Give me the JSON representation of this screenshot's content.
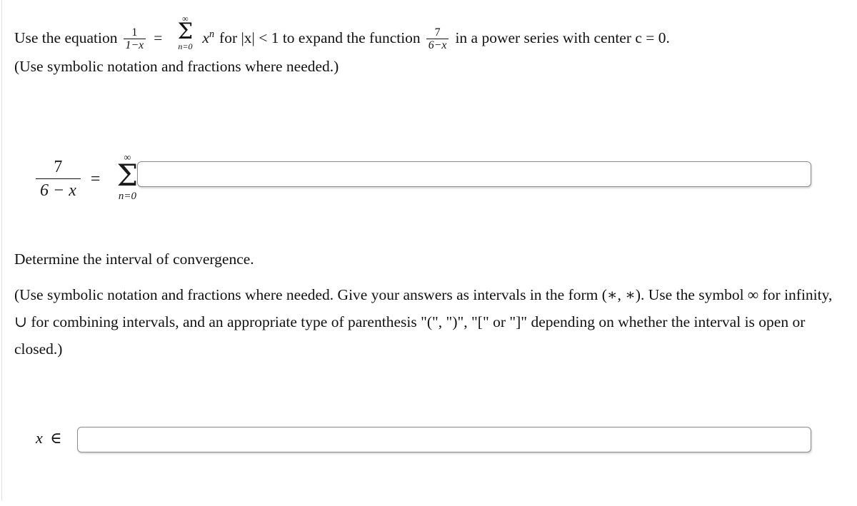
{
  "problem": {
    "prompt_prefix": "Use the equation",
    "equation_inline": {
      "fraction1": {
        "numerator": "1",
        "denominator": "1−x"
      },
      "equals": "=",
      "summation": {
        "upper_limit": "∞",
        "symbol": "Σ",
        "lower_limit": "n=0"
      },
      "term": "x",
      "term_exponent": "n"
    },
    "prompt_middle": "for |x| < 1 to expand the function",
    "function": {
      "numerator": "7",
      "denominator": "6−x"
    },
    "prompt_suffix": "in a power series with center c = 0.",
    "note_1": "(Use symbolic notation and fractions where needed.)"
  },
  "display_equation": {
    "left_fraction": {
      "numerator": "7",
      "denominator": "6 − x"
    },
    "equals": "=",
    "summation": {
      "upper_limit": "∞",
      "symbol": "Σ",
      "lower_limit": "n=0"
    }
  },
  "answer_1": {
    "value": "",
    "placeholder": ""
  },
  "interval_section": {
    "heading": "Determine the interval of convergence.",
    "note": "(Use symbolic notation and fractions where needed. Give your answers as intervals in the form (∗, ∗). Use the symbol ∞ for infinity, ∪ for combining intervals, and an appropriate type of parenthesis \"(\", \")\", \"[\" or \"]\" depending on whether the interval is open or closed.)",
    "answer_label_x": "x",
    "answer_label_in": "∈"
  },
  "answer_2": {
    "value": "",
    "placeholder": ""
  },
  "colors": {
    "text": "#111111",
    "box_border": "#8a8a8a",
    "box_background": "#ffffff",
    "page_background": "#ffffff",
    "page_edge": "#e2e2e2"
  }
}
